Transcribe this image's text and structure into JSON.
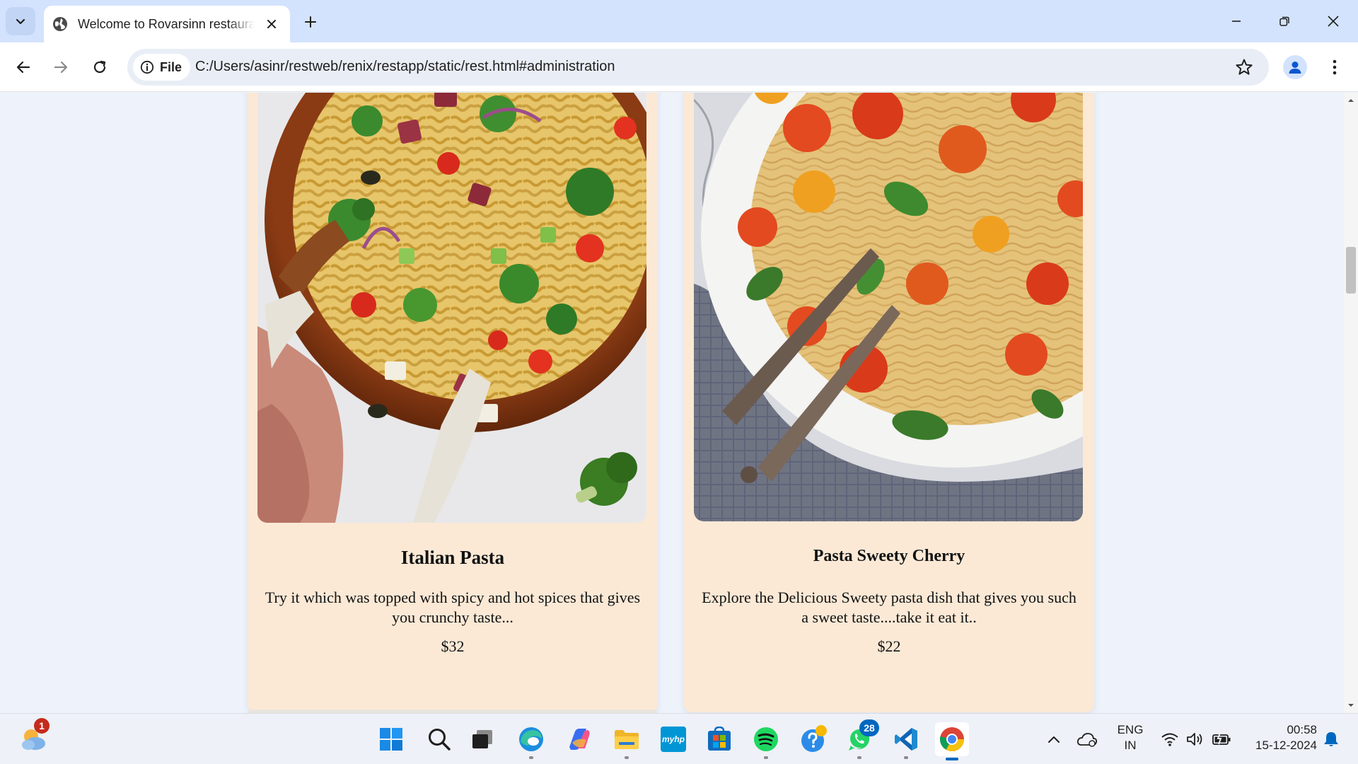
{
  "browser": {
    "tab_title": "Welcome to Rovarsinn restaurant",
    "address_chip": "File",
    "url": "C:/Users/asinr/restweb/renix/restapp/static/rest.html#administration"
  },
  "menu_cards": [
    {
      "title": "Italian Pasta",
      "description": "Try it which was topped with spicy and hot spices that gives you crunchy taste...",
      "price": "$32",
      "image": "italian-pasta-salad-bowl"
    },
    {
      "title": "Pasta Sweety Cherry",
      "description": "Explore the Delicious Sweety pasta dish that gives you such a sweet taste....take it eat it..",
      "price": "$22",
      "image": "spaghetti-cherry-tomato-plate"
    }
  ],
  "taskbar": {
    "weather_badge": "1",
    "whatsapp_badge": "28",
    "language_line1": "ENG",
    "language_line2": "IN",
    "time": "00:58",
    "date": "15-12-2024",
    "apps": [
      "weather-icon",
      "windows-start-icon",
      "search-icon",
      "task-view-icon",
      "edge-icon",
      "copilot-icon",
      "file-explorer-icon",
      "myhp-icon",
      "microsoft-store-icon",
      "spotify-icon",
      "get-help-icon",
      "whatsapp-icon",
      "vscode-icon",
      "chrome-icon"
    ],
    "myhp_label": "myhp"
  },
  "colors": {
    "card_bg": "#fbe9d6",
    "page_bg": "#eef3fb",
    "tabstrip_bg": "#d3e3fd"
  }
}
